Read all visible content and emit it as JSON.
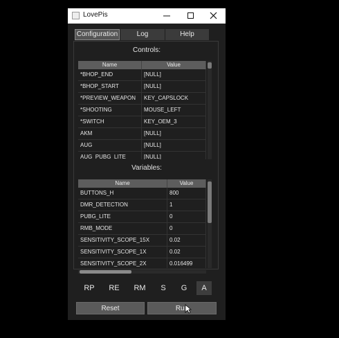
{
  "window": {
    "title": "LovePis"
  },
  "tabs": [
    {
      "label": "Configuration",
      "active": true
    },
    {
      "label": "Log",
      "active": false
    },
    {
      "label": "Help",
      "active": false
    }
  ],
  "controls": {
    "label": "Controls:",
    "columns": [
      "Name",
      "Value"
    ],
    "rows": [
      [
        "*BHOP_END",
        "[NULL]"
      ],
      [
        "*BHOP_START",
        "[NULL]"
      ],
      [
        "*PREVIEW_WEAPON",
        "KEY_CAPSLOCK"
      ],
      [
        "*SHOOTING",
        "MOUSE_LEFT"
      ],
      [
        "*SWITCH",
        "KEY_OEM_3"
      ],
      [
        "AKM",
        "[NULL]"
      ],
      [
        "AUG",
        "[NULL]"
      ],
      [
        "AUG_PUBG_LITE",
        "[NULL]"
      ]
    ]
  },
  "variables": {
    "label": "Variables:",
    "columns": [
      "Name",
      "Value"
    ],
    "rows": [
      [
        "BUTTONS_H",
        "800"
      ],
      [
        "DMR_DETECTION",
        "1"
      ],
      [
        "PUBG_LITE",
        "0"
      ],
      [
        "RMB_MODE",
        "0"
      ],
      [
        "SENSITIVITY_SCOPE_15X",
        "0.02"
      ],
      [
        "SENSITIVITY_SCOPE_1X",
        "0.02"
      ],
      [
        "SENSITIVITY_SCOPE_2X",
        "0.016499"
      ]
    ]
  },
  "toolbar": [
    {
      "label": "RP",
      "active": false
    },
    {
      "label": "RE",
      "active": false
    },
    {
      "label": "RM",
      "active": false
    },
    {
      "label": "S",
      "active": false
    },
    {
      "label": "G",
      "active": false
    },
    {
      "label": "A",
      "active": true
    }
  ],
  "buttons": {
    "reset": "Reset",
    "run": "Run"
  },
  "colors": {
    "window_bg": "#1f1f1f",
    "header_bg": "#5d5d5d",
    "button_bg": "#5a5a5a"
  }
}
